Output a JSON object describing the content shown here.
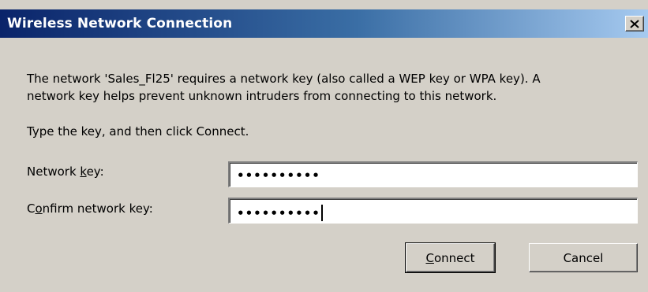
{
  "dialog": {
    "title": "Wireless Network Connection",
    "close_icon": "close-icon",
    "message_line1": "The network 'Sales_Fl25' requires a network key (also called a WEP key or WPA key). A",
    "message_line2": "network key helps prevent unknown intruders from connecting to this network.",
    "instruction": "Type the key, and then click Connect.",
    "network_key": {
      "label_before": "Network ",
      "label_accel": "k",
      "label_after": "ey:",
      "value": "••••••••••"
    },
    "confirm_key": {
      "label_before": "C",
      "label_accel": "o",
      "label_after": "nfirm network key:",
      "value": "••••••••••"
    },
    "connect_button": {
      "accel": "C",
      "rest": "onnect"
    },
    "cancel_label": "Cancel"
  },
  "colors": {
    "face": "#d4d0c8",
    "title_start": "#0a246a",
    "title_end": "#a6caf0"
  }
}
